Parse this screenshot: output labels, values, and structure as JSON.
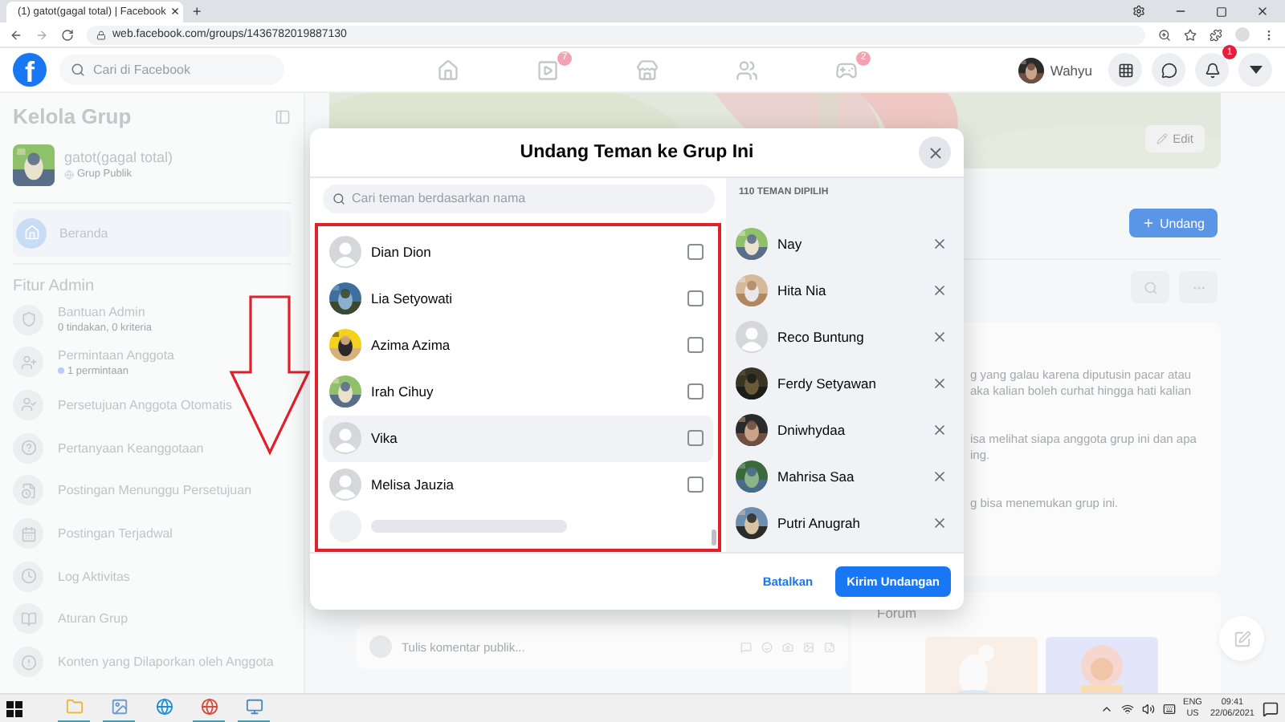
{
  "browser": {
    "tab_title": "(1) gatot(gagal total) | Facebook",
    "tab_close": "×",
    "new_tab": "+",
    "url": "web.facebook.com/groups/1436782019887130"
  },
  "header": {
    "logo": "f",
    "search_placeholder": "Cari di Facebook",
    "video_badge": "7",
    "gaming_badge": "2",
    "user": "Wahyu",
    "notification_badge": "1"
  },
  "sidebar": {
    "title": "Kelola Grup",
    "group_name": "gatot(gagal total)",
    "group_privacy": "Grup Publik",
    "home": "Beranda",
    "section": "Fitur Admin",
    "items": [
      {
        "label": "Bantuan Admin",
        "detail": "0 tindakan, 0 kriteria",
        "new": false
      },
      {
        "label": "Permintaan Anggota",
        "detail": "1 permintaan",
        "new": true
      },
      {
        "label": "Persetujuan Anggota Otomatis"
      },
      {
        "label": "Pertanyaan Keanggotaan"
      },
      {
        "label": "Postingan Menunggu Persetujuan"
      },
      {
        "label": "Postingan Terjadwal"
      },
      {
        "label": "Log Aktivitas"
      },
      {
        "label": "Aturan Grup"
      },
      {
        "label": "Konten yang Dilaporkan oleh Anggota"
      }
    ]
  },
  "main": {
    "edit": "Edit",
    "invite": "Undang",
    "about": [
      [
        "g yang galau karena diputusin pacar atau",
        "aka kalian boleh curhat hingga hati kalian"
      ],
      [
        "isa melihat siapa anggota grup ini dan apa",
        "ing."
      ],
      [
        "g bisa menemukan grup ini."
      ]
    ],
    "forum": "Forum",
    "comment_placeholder": "Tulis komentar publik..."
  },
  "modal": {
    "title": "Undang Teman ke Grup Ini",
    "search_placeholder": "Cari teman berdasarkan nama",
    "friends": [
      {
        "name": "Dian Dion",
        "kind": "default",
        "checked": false,
        "highlighted": false
      },
      {
        "name": "Lia Setyowati",
        "checked": false,
        "highlighted": false
      },
      {
        "name": "Azima Azima",
        "checked": false,
        "highlighted": false
      },
      {
        "name": "Irah Cihuy",
        "checked": false,
        "highlighted": false
      },
      {
        "name": "Vika",
        "kind": "default",
        "checked": false,
        "highlighted": true
      },
      {
        "name": "Melisa Jauzia",
        "kind": "default",
        "checked": false,
        "highlighted": false
      }
    ],
    "selected_label": "110 TEMAN DIPILIH",
    "selected": [
      {
        "name": "Nay"
      },
      {
        "name": "Hita Nia"
      },
      {
        "name": "Reco Buntung",
        "kind": "default"
      },
      {
        "name": "Ferdy Setyawan"
      },
      {
        "name": "Dniwhydaa"
      },
      {
        "name": "Mahrisa Saa"
      },
      {
        "name": "Putri Anugrah"
      }
    ],
    "cancel": "Batalkan",
    "submit": "Kirim Undangan"
  },
  "taskbar": {
    "apps": [
      {
        "active": true
      },
      {
        "active": true
      },
      {
        "active": false
      },
      {
        "active": true
      },
      {
        "active": true
      }
    ],
    "language": "ENG",
    "region": "US",
    "time": "09:41",
    "date": "22/06/2021"
  }
}
